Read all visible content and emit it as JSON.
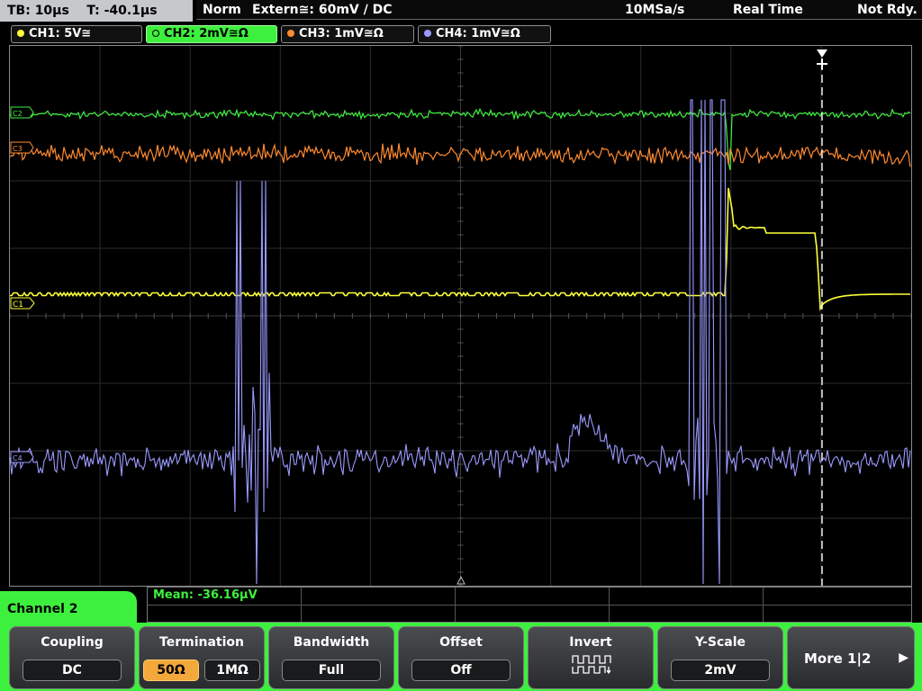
{
  "top_bar": {
    "timebase": "TB: 10µs",
    "trigger_time": "T: -40.1µs",
    "mode": "Norm",
    "trigger_source": "Extern≅: 60mV ∕ DC",
    "sample_rate": "10MSa/s",
    "acquisition": "Real Time",
    "state": "Not Rdy."
  },
  "channel_tabs": [
    {
      "label": "CH1: 5V≅",
      "color": "#ffff3a",
      "active": false
    },
    {
      "label": "CH2: 2mV≅Ω",
      "color": "#3ef03e",
      "active": true
    },
    {
      "label": "CH3: 1mV≅Ω",
      "color": "#ff8a30",
      "active": false
    },
    {
      "label": "CH4: 1mV≅Ω",
      "color": "#9a9aff",
      "active": false
    }
  ],
  "channel_markers": [
    "C2",
    "C3",
    "C1",
    "C4"
  ],
  "measurement": {
    "text": "Mean: -36.16µV"
  },
  "channel_panel": {
    "title": "Channel 2",
    "softkeys": {
      "coupling": {
        "label": "Coupling",
        "value": "DC"
      },
      "termination": {
        "label": "Termination",
        "options": [
          "50Ω",
          "1MΩ"
        ],
        "selected": "50Ω"
      },
      "bandwidth": {
        "label": "Bandwidth",
        "value": "Full"
      },
      "offset": {
        "label": "Offset",
        "value": "Off"
      },
      "invert": {
        "label": "Invert",
        "icon": "invert-waveform-icon"
      },
      "y_scale": {
        "label": "Y-Scale",
        "value": "2mV"
      },
      "more": {
        "label": "More 1|2"
      }
    }
  },
  "colors": {
    "ch1": "#ffff3a",
    "ch2": "#3ef03e",
    "ch3": "#ff8a30",
    "ch4": "#9a9aff",
    "panel": "#3ef03e",
    "selected_option": "#f3a83b"
  }
}
